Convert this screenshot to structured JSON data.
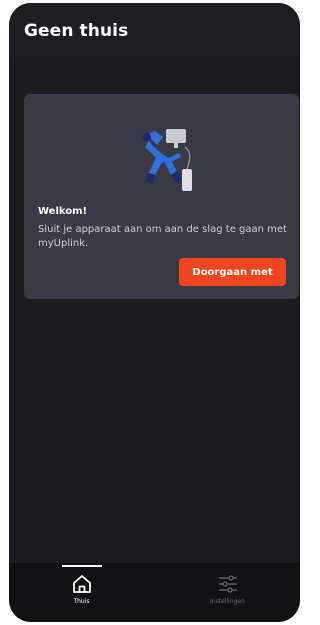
{
  "header": {
    "title": "Geen thuis"
  },
  "welcome_card": {
    "title": "Welkom!",
    "text": "Sluit je apparaat aan om aan de slag te gaan met myUplink.",
    "button_label": "Doorgaan met"
  },
  "bottom_nav": {
    "items": [
      {
        "label": "Thuis",
        "icon": "home-icon",
        "active": true
      },
      {
        "label": "Instellingen",
        "icon": "sliders-icon",
        "active": false
      }
    ]
  },
  "colors": {
    "background": "#1b1b1f",
    "card": "#3a3a46",
    "accent": "#f2441d",
    "illustration_blue": "#2f6fe0"
  }
}
